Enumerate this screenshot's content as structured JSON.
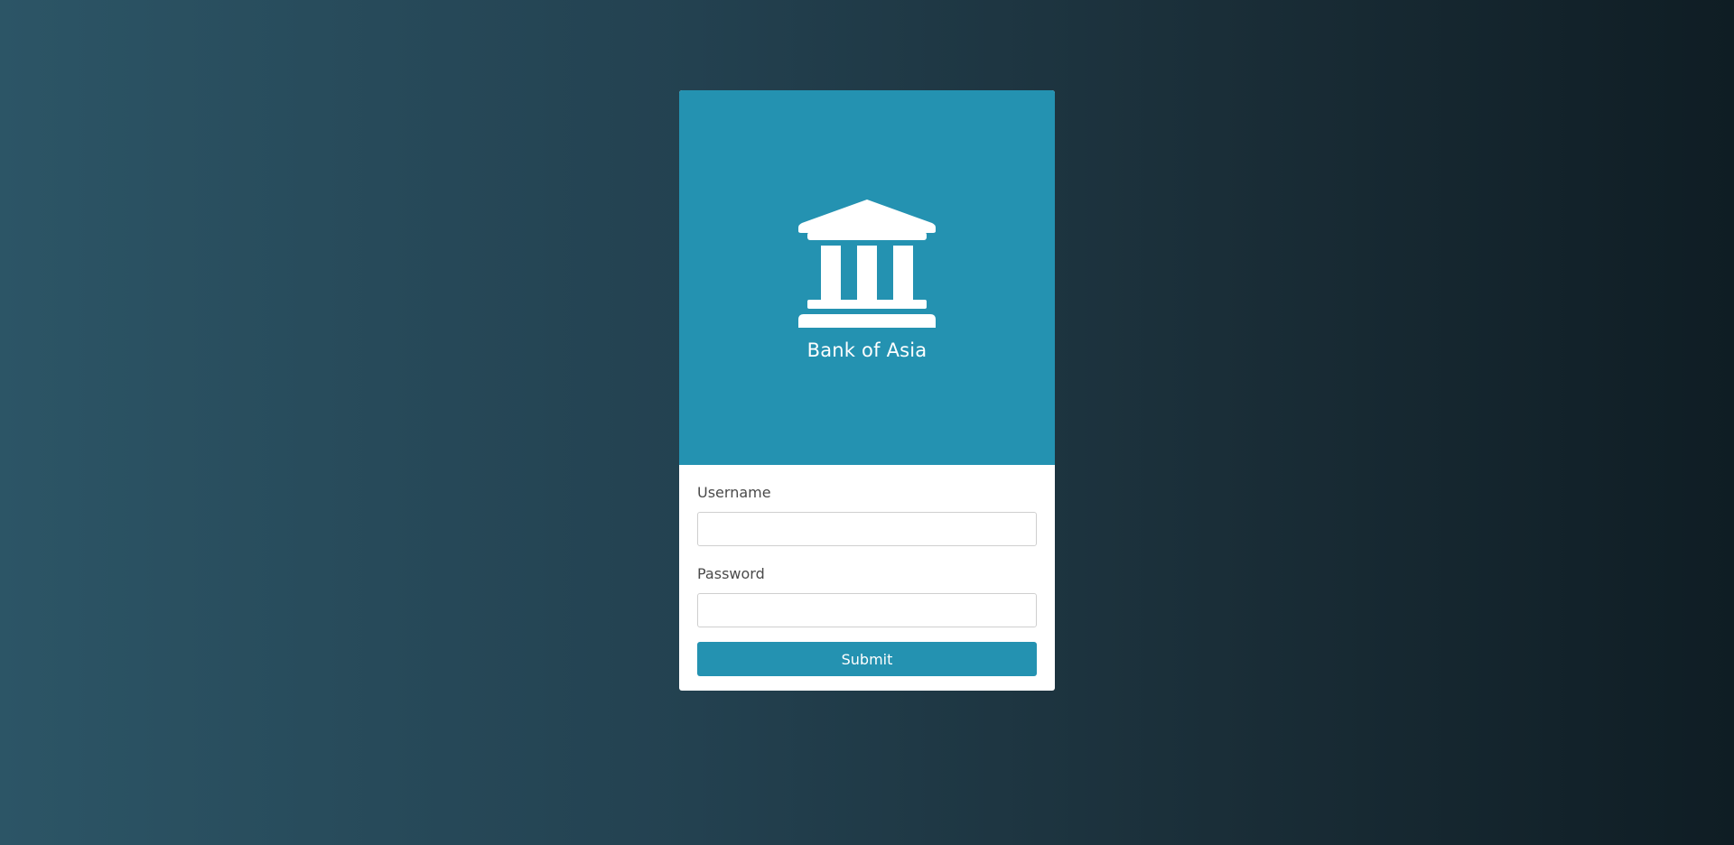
{
  "brand": {
    "name": "Bank of Asia",
    "icon": "bank-building-icon",
    "accent_color": "#2492b1"
  },
  "form": {
    "username_label": "Username",
    "username_value": "",
    "username_placeholder": "",
    "password_label": "Password",
    "password_value": "",
    "password_placeholder": "",
    "submit_label": "Submit"
  }
}
